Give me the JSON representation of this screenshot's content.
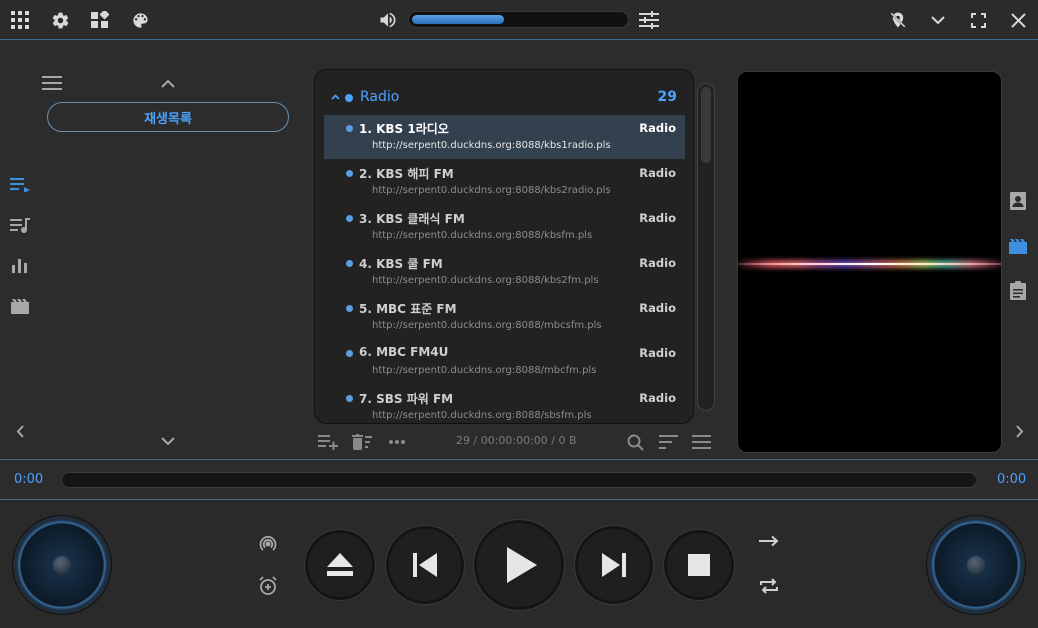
{
  "toolbar": {
    "icons": [
      "apps-grid-icon",
      "settings-gear-icon",
      "widgets-icon",
      "palette-icon",
      "volume-icon",
      "equalizer-icon",
      "location-off-icon",
      "chevron-down-icon",
      "fullscreen-icon",
      "close-icon"
    ],
    "volume_level": 0.43
  },
  "sidebar": {
    "playlist_button_label": "재생목록",
    "icons": [
      "menu-icon",
      "chevron-up-icon",
      "playlist-play-icon",
      "queue-music-icon",
      "bar-chart-icon",
      "movie-icon",
      "chevron-left-icon",
      "chevron-down-icon"
    ]
  },
  "playlist": {
    "group_title": "Radio",
    "group_count": "29",
    "selected_index": 0,
    "items": [
      {
        "title": "1. KBS 1라디오",
        "type": "Radio",
        "url": "http://serpent0.duckdns.org:8088/kbs1radio.pls"
      },
      {
        "title": "2. KBS 해피 FM",
        "type": "Radio",
        "url": "http://serpent0.duckdns.org:8088/kbs2radio.pls"
      },
      {
        "title": "3. KBS 클래식 FM",
        "type": "Radio",
        "url": "http://serpent0.duckdns.org:8088/kbsfm.pls"
      },
      {
        "title": "4. KBS 쿨 FM",
        "type": "Radio",
        "url": "http://serpent0.duckdns.org:8088/kbs2fm.pls"
      },
      {
        "title": "5. MBC 표준 FM",
        "type": "Radio",
        "url": "http://serpent0.duckdns.org:8088/mbcsfm.pls"
      },
      {
        "title": "6. MBC FM4U",
        "type": "Radio",
        "url": "http://serpent0.duckdns.org:8088/mbcfm.pls"
      },
      {
        "title": "7. SBS 파워 FM",
        "type": "Radio",
        "url": "http://serpent0.duckdns.org:8088/sbsfm.pls"
      }
    ],
    "status": "29 / 00:00:00:00 / 0 B",
    "toolbar_icons": [
      "playlist-add-icon",
      "delete-sweep-icon",
      "more-horiz-icon",
      "search-icon",
      "sort-icon",
      "menu-icon"
    ]
  },
  "right_rail": {
    "icons": [
      "contact-icon",
      "movie-icon",
      "clipboard-icon",
      "chevron-right-icon"
    ],
    "active": "movie-icon"
  },
  "progress": {
    "elapsed": "0:00",
    "total": "0:00",
    "position": 0
  },
  "controls": {
    "icons": [
      "podcast-icon",
      "alarm-add-icon",
      "eject-icon",
      "previous-icon",
      "play-icon",
      "next-icon",
      "stop-icon",
      "arrow-right-icon",
      "repeat-icon"
    ]
  },
  "colors": {
    "accent": "#4aa3ff",
    "background": "#2c2c2c",
    "separator": "#3f6a92",
    "selected_row": "#33414f"
  }
}
